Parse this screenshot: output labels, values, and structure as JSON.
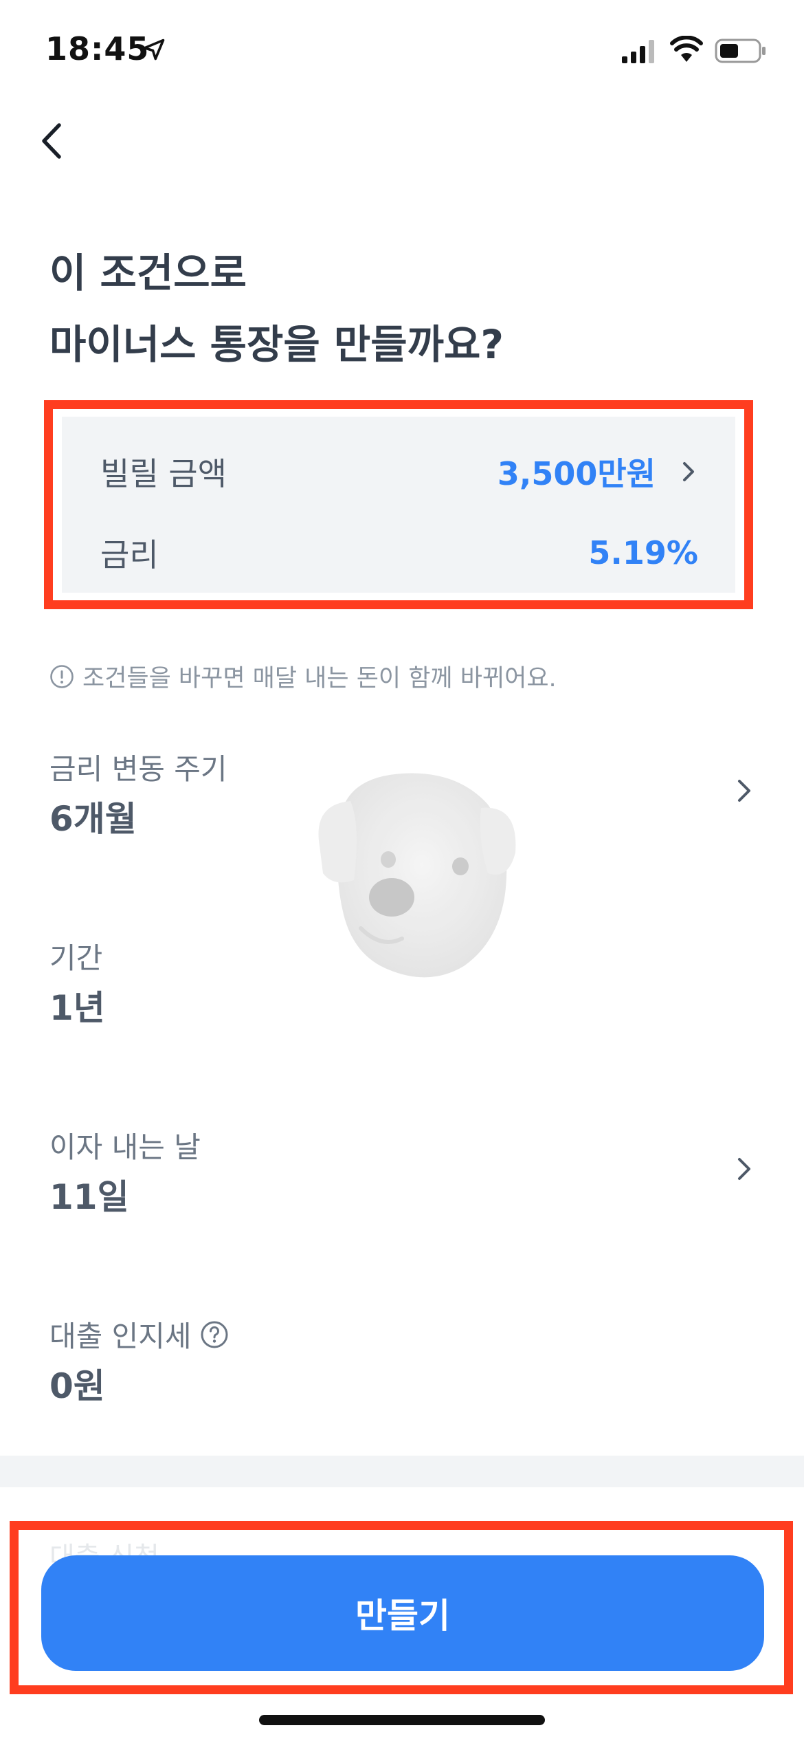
{
  "status_bar": {
    "time": "18:45"
  },
  "nav": {
    "back_icon": "chevron-left-icon"
  },
  "title": {
    "line1": "이 조건으로",
    "line2": "마이너스 통장을 만들까요?"
  },
  "summary": {
    "amount_label": "빌릴 금액",
    "amount_value": "3,500만원",
    "rate_label": "금리",
    "rate_value": "5.19%"
  },
  "notice": {
    "text": "조건들을 바꾸면 매달 내는 돈이 함께 바뀌어요."
  },
  "details": {
    "cycle_label": "금리 변동 주기",
    "cycle_value": "6개월",
    "period_label": "기간",
    "period_value": "1년",
    "interest_label": "이자 내는 날",
    "interest_value": "11일",
    "stamp_label": "대출 인지세",
    "stamp_value": "0원"
  },
  "bottom": {
    "faded_text": "대출 신청",
    "button_label": "만들기"
  },
  "colors": {
    "accent": "#3182f6",
    "highlight": "#ff3d1f",
    "card_bg": "#f2f4f6",
    "text_primary": "#333d4b",
    "text_secondary": "#6b7684"
  }
}
